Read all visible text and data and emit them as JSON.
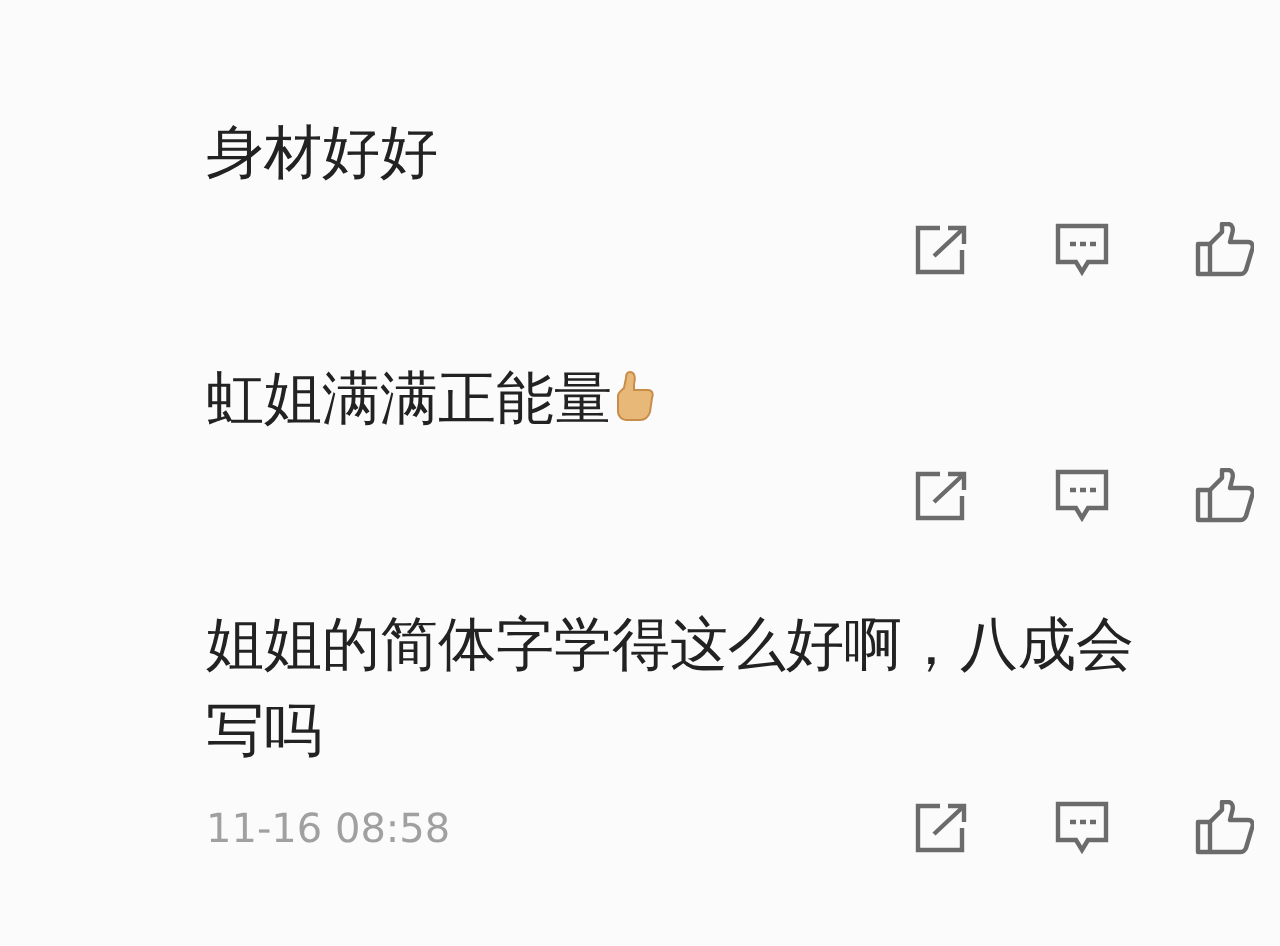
{
  "comments": [
    {
      "text": "身材好好",
      "emoji": false
    },
    {
      "text": "虹姐满满正能量",
      "emoji": true
    },
    {
      "text": "姐姐的简体字学得这么好啊，八成会写吗",
      "emoji": false,
      "time": "11-16 08:58"
    }
  ]
}
